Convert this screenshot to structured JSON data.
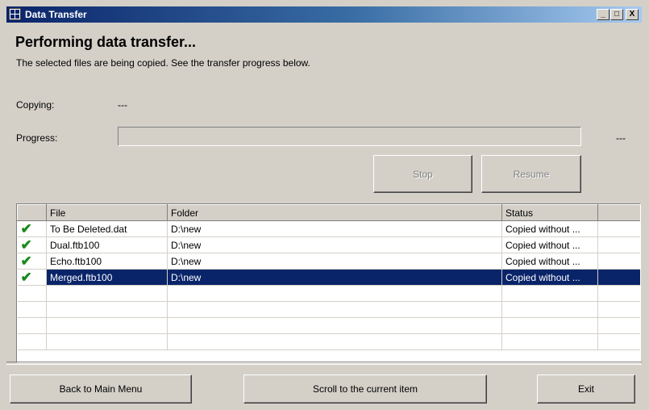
{
  "window": {
    "title": "Data Transfer",
    "controls": {
      "minimize": "_",
      "maximize": "□",
      "close": "X"
    }
  },
  "header": {
    "title": "Performing data transfer...",
    "subtitle": "The selected files are being copied. See the transfer progress below."
  },
  "copying": {
    "label": "Copying:",
    "value": "---"
  },
  "progress": {
    "label": "Progress:",
    "value_text": "---",
    "fraction": 0
  },
  "buttons": {
    "stop": "Stop",
    "resume": "Resume"
  },
  "table": {
    "columns": [
      "",
      "File",
      "Folder",
      "Status",
      ""
    ],
    "rows": [
      {
        "icon": "check-icon",
        "file": "To Be Deleted.dat",
        "folder": "D:\\new",
        "status": "Copied without ..."
      },
      {
        "icon": "check-icon",
        "file": "Dual.ftb100",
        "folder": "D:\\new",
        "status": "Copied without ..."
      },
      {
        "icon": "check-icon",
        "file": "Echo.ftb100",
        "folder": "D:\\new",
        "status": "Copied without ..."
      },
      {
        "icon": "check-icon",
        "file": "Merged.ftb100",
        "folder": "D:\\new",
        "status": "Copied without ...",
        "selected": true
      }
    ]
  },
  "footer": {
    "back": "Back to Main Menu",
    "scroll": "Scroll to the current item",
    "exit": "Exit"
  },
  "colors": {
    "selection": "#0a246a",
    "check": "#1a8a1a",
    "window_bg": "#d4d0c8"
  }
}
